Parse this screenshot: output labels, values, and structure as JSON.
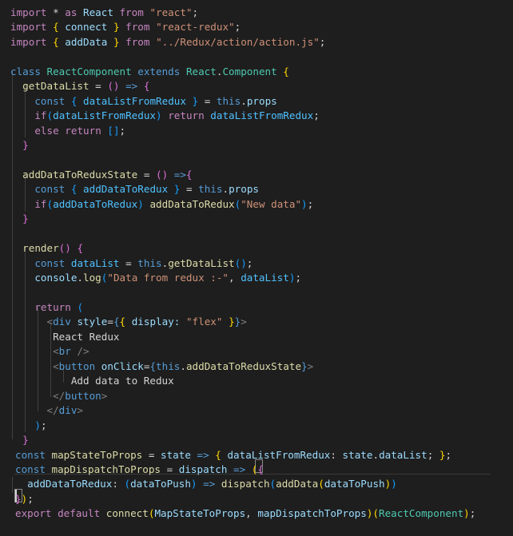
{
  "colors": {
    "background": "#1e1e1e",
    "keyword_blue": "#569cd6",
    "control_purple": "#c586c0",
    "variable_light_blue": "#9cdcfe",
    "function_yellow": "#dcdcaa",
    "string_orange": "#ce9178",
    "class_teal": "#4ec9b0",
    "brace_gold": "#ffd700",
    "bracket_purple": "#da70d6",
    "bracket_blue": "#179fff",
    "jsx_tag_gray": "#808080",
    "default_text": "#d4d4d4"
  },
  "code_lines": [
    [
      {
        "t": "import",
        "c": "#c586c0"
      },
      {
        "t": " * ",
        "c": "#d4d4d4"
      },
      {
        "t": "as",
        "c": "#c586c0"
      },
      {
        "t": " React ",
        "c": "#9cdcfe"
      },
      {
        "t": "from",
        "c": "#c586c0"
      },
      {
        "t": " ",
        "c": "#d4d4d4"
      },
      {
        "t": "\"react\"",
        "c": "#ce9178"
      },
      {
        "t": ";",
        "c": "#d4d4d4"
      }
    ],
    [
      {
        "t": "import",
        "c": "#c586c0"
      },
      {
        "t": " ",
        "c": "#d4d4d4"
      },
      {
        "t": "{",
        "c": "#ffd700"
      },
      {
        "t": " connect ",
        "c": "#9cdcfe"
      },
      {
        "t": "}",
        "c": "#ffd700"
      },
      {
        "t": " ",
        "c": "#d4d4d4"
      },
      {
        "t": "from",
        "c": "#c586c0"
      },
      {
        "t": " ",
        "c": "#d4d4d4"
      },
      {
        "t": "\"react-redux\"",
        "c": "#ce9178"
      },
      {
        "t": ";",
        "c": "#d4d4d4"
      }
    ],
    [
      {
        "t": "import",
        "c": "#c586c0"
      },
      {
        "t": " ",
        "c": "#d4d4d4"
      },
      {
        "t": "{",
        "c": "#ffd700"
      },
      {
        "t": " addData ",
        "c": "#9cdcfe"
      },
      {
        "t": "}",
        "c": "#ffd700"
      },
      {
        "t": " ",
        "c": "#d4d4d4"
      },
      {
        "t": "from",
        "c": "#c586c0"
      },
      {
        "t": " ",
        "c": "#d4d4d4"
      },
      {
        "t": "\"../Redux/action/action.js\"",
        "c": "#ce9178"
      },
      {
        "t": ";",
        "c": "#d4d4d4"
      }
    ],
    [],
    [
      {
        "t": "class",
        "c": "#569cd6"
      },
      {
        "t": " ",
        "c": "#d4d4d4"
      },
      {
        "t": "ReactComponent",
        "c": "#4ec9b0"
      },
      {
        "t": " ",
        "c": "#d4d4d4"
      },
      {
        "t": "extends",
        "c": "#569cd6"
      },
      {
        "t": " ",
        "c": "#d4d4d4"
      },
      {
        "t": "React",
        "c": "#4ec9b0"
      },
      {
        "t": ".",
        "c": "#d4d4d4"
      },
      {
        "t": "Component",
        "c": "#4ec9b0"
      },
      {
        "t": " ",
        "c": "#d4d4d4"
      },
      {
        "t": "{",
        "c": "#ffd700"
      }
    ],
    [
      {
        "t": "  ",
        "c": "#d4d4d4"
      },
      {
        "t": "getDataList",
        "c": "#dcdcaa"
      },
      {
        "t": " = ",
        "c": "#d4d4d4"
      },
      {
        "t": "()",
        "c": "#da70d6"
      },
      {
        "t": " ",
        "c": "#d4d4d4"
      },
      {
        "t": "=>",
        "c": "#569cd6"
      },
      {
        "t": " ",
        "c": "#d4d4d4"
      },
      {
        "t": "{",
        "c": "#da70d6"
      }
    ],
    [
      {
        "t": "    ",
        "c": "#d4d4d4"
      },
      {
        "t": "const",
        "c": "#569cd6"
      },
      {
        "t": " ",
        "c": "#d4d4d4"
      },
      {
        "t": "{",
        "c": "#179fff"
      },
      {
        "t": " ",
        "c": "#d4d4d4"
      },
      {
        "t": "dataListFromRedux",
        "c": "#4fc1ff"
      },
      {
        "t": " ",
        "c": "#d4d4d4"
      },
      {
        "t": "}",
        "c": "#179fff"
      },
      {
        "t": " = ",
        "c": "#d4d4d4"
      },
      {
        "t": "this",
        "c": "#569cd6"
      },
      {
        "t": ".",
        "c": "#d4d4d4"
      },
      {
        "t": "props",
        "c": "#9cdcfe"
      }
    ],
    [
      {
        "t": "    ",
        "c": "#d4d4d4"
      },
      {
        "t": "if",
        "c": "#c586c0"
      },
      {
        "t": "(",
        "c": "#179fff"
      },
      {
        "t": "dataListFromRedux",
        "c": "#4fc1ff"
      },
      {
        "t": ")",
        "c": "#179fff"
      },
      {
        "t": " ",
        "c": "#d4d4d4"
      },
      {
        "t": "return",
        "c": "#c586c0"
      },
      {
        "t": " ",
        "c": "#d4d4d4"
      },
      {
        "t": "dataListFromRedux",
        "c": "#4fc1ff"
      },
      {
        "t": ";",
        "c": "#d4d4d4"
      }
    ],
    [
      {
        "t": "    ",
        "c": "#d4d4d4"
      },
      {
        "t": "else",
        "c": "#c586c0"
      },
      {
        "t": " ",
        "c": "#d4d4d4"
      },
      {
        "t": "return",
        "c": "#c586c0"
      },
      {
        "t": " ",
        "c": "#d4d4d4"
      },
      {
        "t": "[]",
        "c": "#179fff"
      },
      {
        "t": ";",
        "c": "#d4d4d4"
      }
    ],
    [
      {
        "t": "  ",
        "c": "#d4d4d4"
      },
      {
        "t": "}",
        "c": "#da70d6"
      }
    ],
    [],
    [
      {
        "t": "  ",
        "c": "#d4d4d4"
      },
      {
        "t": "addDataToReduxState",
        "c": "#dcdcaa"
      },
      {
        "t": " = ",
        "c": "#d4d4d4"
      },
      {
        "t": "()",
        "c": "#da70d6"
      },
      {
        "t": " ",
        "c": "#d4d4d4"
      },
      {
        "t": "=>",
        "c": "#569cd6"
      },
      {
        "t": "{",
        "c": "#da70d6"
      }
    ],
    [
      {
        "t": "    ",
        "c": "#d4d4d4"
      },
      {
        "t": "const",
        "c": "#569cd6"
      },
      {
        "t": " ",
        "c": "#d4d4d4"
      },
      {
        "t": "{",
        "c": "#179fff"
      },
      {
        "t": " ",
        "c": "#d4d4d4"
      },
      {
        "t": "addDataToRedux",
        "c": "#4fc1ff"
      },
      {
        "t": " ",
        "c": "#d4d4d4"
      },
      {
        "t": "}",
        "c": "#179fff"
      },
      {
        "t": " = ",
        "c": "#d4d4d4"
      },
      {
        "t": "this",
        "c": "#569cd6"
      },
      {
        "t": ".",
        "c": "#d4d4d4"
      },
      {
        "t": "props",
        "c": "#9cdcfe"
      }
    ],
    [
      {
        "t": "    ",
        "c": "#d4d4d4"
      },
      {
        "t": "if",
        "c": "#c586c0"
      },
      {
        "t": "(",
        "c": "#179fff"
      },
      {
        "t": "addDataToRedux",
        "c": "#4fc1ff"
      },
      {
        "t": ")",
        "c": "#179fff"
      },
      {
        "t": " ",
        "c": "#d4d4d4"
      },
      {
        "t": "addDataToRedux",
        "c": "#dcdcaa"
      },
      {
        "t": "(",
        "c": "#179fff"
      },
      {
        "t": "\"New data\"",
        "c": "#ce9178"
      },
      {
        "t": ")",
        "c": "#179fff"
      },
      {
        "t": ";",
        "c": "#d4d4d4"
      }
    ],
    [
      {
        "t": "  ",
        "c": "#d4d4d4"
      },
      {
        "t": "}",
        "c": "#da70d6"
      }
    ],
    [],
    [
      {
        "t": "  ",
        "c": "#d4d4d4"
      },
      {
        "t": "render",
        "c": "#dcdcaa"
      },
      {
        "t": "()",
        "c": "#da70d6"
      },
      {
        "t": " ",
        "c": "#d4d4d4"
      },
      {
        "t": "{",
        "c": "#da70d6"
      }
    ],
    [
      {
        "t": "    ",
        "c": "#d4d4d4"
      },
      {
        "t": "const",
        "c": "#569cd6"
      },
      {
        "t": " ",
        "c": "#d4d4d4"
      },
      {
        "t": "dataList",
        "c": "#4fc1ff"
      },
      {
        "t": " = ",
        "c": "#d4d4d4"
      },
      {
        "t": "this",
        "c": "#569cd6"
      },
      {
        "t": ".",
        "c": "#d4d4d4"
      },
      {
        "t": "getDataList",
        "c": "#dcdcaa"
      },
      {
        "t": "()",
        "c": "#179fff"
      },
      {
        "t": ";",
        "c": "#d4d4d4"
      }
    ],
    [
      {
        "t": "    ",
        "c": "#d4d4d4"
      },
      {
        "t": "console",
        "c": "#9cdcfe"
      },
      {
        "t": ".",
        "c": "#d4d4d4"
      },
      {
        "t": "log",
        "c": "#dcdcaa"
      },
      {
        "t": "(",
        "c": "#179fff"
      },
      {
        "t": "\"Data from redux :-\"",
        "c": "#ce9178"
      },
      {
        "t": ", ",
        "c": "#d4d4d4"
      },
      {
        "t": "dataList",
        "c": "#4fc1ff"
      },
      {
        "t": ")",
        "c": "#179fff"
      },
      {
        "t": ";",
        "c": "#d4d4d4"
      }
    ],
    [],
    [
      {
        "t": "    ",
        "c": "#d4d4d4"
      },
      {
        "t": "return",
        "c": "#c586c0"
      },
      {
        "t": " ",
        "c": "#d4d4d4"
      },
      {
        "t": "(",
        "c": "#179fff"
      }
    ],
    [
      {
        "t": "      ",
        "c": "#d4d4d4"
      },
      {
        "t": "<",
        "c": "#808080"
      },
      {
        "t": "div",
        "c": "#569cd6"
      },
      {
        "t": " ",
        "c": "#d4d4d4"
      },
      {
        "t": "style",
        "c": "#9cdcfe"
      },
      {
        "t": "=",
        "c": "#d4d4d4"
      },
      {
        "t": "{",
        "c": "#569cd6"
      },
      {
        "t": "{",
        "c": "#ffd700"
      },
      {
        "t": " display: ",
        "c": "#9cdcfe"
      },
      {
        "t": "\"flex\"",
        "c": "#ce9178"
      },
      {
        "t": " ",
        "c": "#d4d4d4"
      },
      {
        "t": "}",
        "c": "#ffd700"
      },
      {
        "t": "}",
        "c": "#569cd6"
      },
      {
        "t": ">",
        "c": "#808080"
      }
    ],
    [
      {
        "t": "       React Redux",
        "c": "#d4d4d4"
      }
    ],
    [
      {
        "t": "       ",
        "c": "#d4d4d4"
      },
      {
        "t": "<",
        "c": "#808080"
      },
      {
        "t": "br",
        "c": "#569cd6"
      },
      {
        "t": " />",
        "c": "#808080"
      }
    ],
    [
      {
        "t": "       ",
        "c": "#d4d4d4"
      },
      {
        "t": "<",
        "c": "#808080"
      },
      {
        "t": "button",
        "c": "#569cd6"
      },
      {
        "t": " ",
        "c": "#d4d4d4"
      },
      {
        "t": "onClick",
        "c": "#9cdcfe"
      },
      {
        "t": "=",
        "c": "#d4d4d4"
      },
      {
        "t": "{",
        "c": "#569cd6"
      },
      {
        "t": "this",
        "c": "#569cd6"
      },
      {
        "t": ".",
        "c": "#d4d4d4"
      },
      {
        "t": "addDataToReduxState",
        "c": "#dcdcaa"
      },
      {
        "t": "}",
        "c": "#569cd6"
      },
      {
        "t": ">",
        "c": "#808080"
      }
    ],
    [
      {
        "t": "          Add data to Redux",
        "c": "#d4d4d4"
      }
    ],
    [
      {
        "t": "       ",
        "c": "#d4d4d4"
      },
      {
        "t": "</",
        "c": "#808080"
      },
      {
        "t": "button",
        "c": "#569cd6"
      },
      {
        "t": ">",
        "c": "#808080"
      }
    ],
    [
      {
        "t": "      ",
        "c": "#d4d4d4"
      },
      {
        "t": "</",
        "c": "#808080"
      },
      {
        "t": "div",
        "c": "#569cd6"
      },
      {
        "t": ">",
        "c": "#808080"
      }
    ],
    [
      {
        "t": "    ",
        "c": "#d4d4d4"
      },
      {
        "t": ")",
        "c": "#179fff"
      },
      {
        "t": ";",
        "c": "#d4d4d4"
      }
    ],
    [
      {
        "t": "  ",
        "c": "#d4d4d4"
      },
      {
        "t": "}",
        "c": "#da70d6"
      }
    ],
    [
      {
        "t": "const",
        "c": "#569cd6"
      },
      {
        "t": " ",
        "c": "#d4d4d4"
      },
      {
        "t": "mapStateToProps",
        "c": "#dcdcaa"
      },
      {
        "t": " = ",
        "c": "#d4d4d4"
      },
      {
        "t": "state",
        "c": "#9cdcfe"
      },
      {
        "t": " ",
        "c": "#d4d4d4"
      },
      {
        "t": "=>",
        "c": "#569cd6"
      },
      {
        "t": " ",
        "c": "#d4d4d4"
      },
      {
        "t": "{",
        "c": "#ffd700"
      },
      {
        "t": " ",
        "c": "#d4d4d4"
      },
      {
        "t": "dataListFromRedux",
        "c": "#9cdcfe"
      },
      {
        "t": ": ",
        "c": "#d4d4d4"
      },
      {
        "t": "state",
        "c": "#9cdcfe"
      },
      {
        "t": ".",
        "c": "#d4d4d4"
      },
      {
        "t": "dataList",
        "c": "#9cdcfe"
      },
      {
        "t": "; ",
        "c": "#d4d4d4"
      },
      {
        "t": "}",
        "c": "#ffd700"
      },
      {
        "t": ";",
        "c": "#d4d4d4"
      }
    ],
    [
      {
        "t": "const",
        "c": "#569cd6"
      },
      {
        "t": " ",
        "c": "#d4d4d4"
      },
      {
        "t": "mapDispatchToProps",
        "c": "#dcdcaa"
      },
      {
        "t": " = ",
        "c": "#d4d4d4"
      },
      {
        "t": "dispatch",
        "c": "#9cdcfe"
      },
      {
        "t": " ",
        "c": "#d4d4d4"
      },
      {
        "t": "=>",
        "c": "#569cd6"
      },
      {
        "t": " ",
        "c": "#d4d4d4"
      },
      {
        "t": "(",
        "c": "#ffd700"
      },
      {
        "t": "{",
        "c": "#da70d6"
      }
    ],
    [
      {
        "t": "  ",
        "c": "#d4d4d4"
      },
      {
        "t": "addDataToRedux",
        "c": "#9cdcfe"
      },
      {
        "t": ": ",
        "c": "#d4d4d4"
      },
      {
        "t": "(",
        "c": "#179fff"
      },
      {
        "t": "dataToPush",
        "c": "#9cdcfe"
      },
      {
        "t": ")",
        "c": "#179fff"
      },
      {
        "t": " ",
        "c": "#d4d4d4"
      },
      {
        "t": "=>",
        "c": "#569cd6"
      },
      {
        "t": " ",
        "c": "#d4d4d4"
      },
      {
        "t": "dispatch",
        "c": "#dcdcaa"
      },
      {
        "t": "(",
        "c": "#179fff"
      },
      {
        "t": "addData",
        "c": "#dcdcaa"
      },
      {
        "t": "(",
        "c": "#ffd700"
      },
      {
        "t": "dataToPush",
        "c": "#9cdcfe"
      },
      {
        "t": ")",
        "c": "#ffd700"
      },
      {
        "t": ")",
        "c": "#179fff"
      }
    ],
    [
      {
        "t": "}",
        "c": "#da70d6"
      },
      {
        "t": ")",
        "c": "#ffd700"
      },
      {
        "t": ";",
        "c": "#d4d4d4"
      }
    ],
    [
      {
        "t": "export",
        "c": "#c586c0"
      },
      {
        "t": " ",
        "c": "#d4d4d4"
      },
      {
        "t": "default",
        "c": "#c586c0"
      },
      {
        "t": " ",
        "c": "#d4d4d4"
      },
      {
        "t": "connect",
        "c": "#dcdcaa"
      },
      {
        "t": "(",
        "c": "#ffd700"
      },
      {
        "t": "MapStateToProps",
        "c": "#9cdcfe"
      },
      {
        "t": ", ",
        "c": "#d4d4d4"
      },
      {
        "t": "mapDispatchToProps",
        "c": "#9cdcfe"
      },
      {
        "t": ")",
        "c": "#ffd700"
      },
      {
        "t": "(",
        "c": "#ffd700"
      },
      {
        "t": "ReactComponent",
        "c": "#4ec9b0"
      },
      {
        "t": ")",
        "c": "#ffd700"
      },
      {
        "t": ";",
        "c": "#d4d4d4"
      }
    ]
  ]
}
